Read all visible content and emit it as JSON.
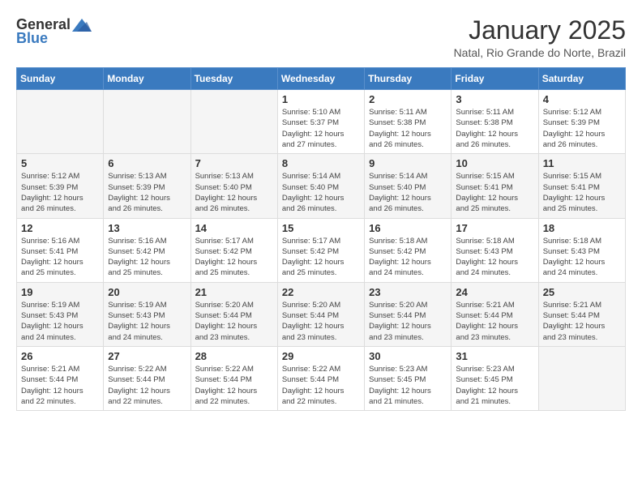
{
  "header": {
    "logo": {
      "general": "General",
      "blue": "Blue"
    },
    "title": "January 2025",
    "subtitle": "Natal, Rio Grande do Norte, Brazil"
  },
  "weekdays": [
    "Sunday",
    "Monday",
    "Tuesday",
    "Wednesday",
    "Thursday",
    "Friday",
    "Saturday"
  ],
  "weeks": [
    [
      {
        "day": "",
        "info": ""
      },
      {
        "day": "",
        "info": ""
      },
      {
        "day": "",
        "info": ""
      },
      {
        "day": "1",
        "info": "Sunrise: 5:10 AM\nSunset: 5:37 PM\nDaylight: 12 hours\nand 27 minutes."
      },
      {
        "day": "2",
        "info": "Sunrise: 5:11 AM\nSunset: 5:38 PM\nDaylight: 12 hours\nand 26 minutes."
      },
      {
        "day": "3",
        "info": "Sunrise: 5:11 AM\nSunset: 5:38 PM\nDaylight: 12 hours\nand 26 minutes."
      },
      {
        "day": "4",
        "info": "Sunrise: 5:12 AM\nSunset: 5:39 PM\nDaylight: 12 hours\nand 26 minutes."
      }
    ],
    [
      {
        "day": "5",
        "info": "Sunrise: 5:12 AM\nSunset: 5:39 PM\nDaylight: 12 hours\nand 26 minutes."
      },
      {
        "day": "6",
        "info": "Sunrise: 5:13 AM\nSunset: 5:39 PM\nDaylight: 12 hours\nand 26 minutes."
      },
      {
        "day": "7",
        "info": "Sunrise: 5:13 AM\nSunset: 5:40 PM\nDaylight: 12 hours\nand 26 minutes."
      },
      {
        "day": "8",
        "info": "Sunrise: 5:14 AM\nSunset: 5:40 PM\nDaylight: 12 hours\nand 26 minutes."
      },
      {
        "day": "9",
        "info": "Sunrise: 5:14 AM\nSunset: 5:40 PM\nDaylight: 12 hours\nand 26 minutes."
      },
      {
        "day": "10",
        "info": "Sunrise: 5:15 AM\nSunset: 5:41 PM\nDaylight: 12 hours\nand 25 minutes."
      },
      {
        "day": "11",
        "info": "Sunrise: 5:15 AM\nSunset: 5:41 PM\nDaylight: 12 hours\nand 25 minutes."
      }
    ],
    [
      {
        "day": "12",
        "info": "Sunrise: 5:16 AM\nSunset: 5:41 PM\nDaylight: 12 hours\nand 25 minutes."
      },
      {
        "day": "13",
        "info": "Sunrise: 5:16 AM\nSunset: 5:42 PM\nDaylight: 12 hours\nand 25 minutes."
      },
      {
        "day": "14",
        "info": "Sunrise: 5:17 AM\nSunset: 5:42 PM\nDaylight: 12 hours\nand 25 minutes."
      },
      {
        "day": "15",
        "info": "Sunrise: 5:17 AM\nSunset: 5:42 PM\nDaylight: 12 hours\nand 25 minutes."
      },
      {
        "day": "16",
        "info": "Sunrise: 5:18 AM\nSunset: 5:42 PM\nDaylight: 12 hours\nand 24 minutes."
      },
      {
        "day": "17",
        "info": "Sunrise: 5:18 AM\nSunset: 5:43 PM\nDaylight: 12 hours\nand 24 minutes."
      },
      {
        "day": "18",
        "info": "Sunrise: 5:18 AM\nSunset: 5:43 PM\nDaylight: 12 hours\nand 24 minutes."
      }
    ],
    [
      {
        "day": "19",
        "info": "Sunrise: 5:19 AM\nSunset: 5:43 PM\nDaylight: 12 hours\nand 24 minutes."
      },
      {
        "day": "20",
        "info": "Sunrise: 5:19 AM\nSunset: 5:43 PM\nDaylight: 12 hours\nand 24 minutes."
      },
      {
        "day": "21",
        "info": "Sunrise: 5:20 AM\nSunset: 5:44 PM\nDaylight: 12 hours\nand 23 minutes."
      },
      {
        "day": "22",
        "info": "Sunrise: 5:20 AM\nSunset: 5:44 PM\nDaylight: 12 hours\nand 23 minutes."
      },
      {
        "day": "23",
        "info": "Sunrise: 5:20 AM\nSunset: 5:44 PM\nDaylight: 12 hours\nand 23 minutes."
      },
      {
        "day": "24",
        "info": "Sunrise: 5:21 AM\nSunset: 5:44 PM\nDaylight: 12 hours\nand 23 minutes."
      },
      {
        "day": "25",
        "info": "Sunrise: 5:21 AM\nSunset: 5:44 PM\nDaylight: 12 hours\nand 23 minutes."
      }
    ],
    [
      {
        "day": "26",
        "info": "Sunrise: 5:21 AM\nSunset: 5:44 PM\nDaylight: 12 hours\nand 22 minutes."
      },
      {
        "day": "27",
        "info": "Sunrise: 5:22 AM\nSunset: 5:44 PM\nDaylight: 12 hours\nand 22 minutes."
      },
      {
        "day": "28",
        "info": "Sunrise: 5:22 AM\nSunset: 5:44 PM\nDaylight: 12 hours\nand 22 minutes."
      },
      {
        "day": "29",
        "info": "Sunrise: 5:22 AM\nSunset: 5:44 PM\nDaylight: 12 hours\nand 22 minutes."
      },
      {
        "day": "30",
        "info": "Sunrise: 5:23 AM\nSunset: 5:45 PM\nDaylight: 12 hours\nand 21 minutes."
      },
      {
        "day": "31",
        "info": "Sunrise: 5:23 AM\nSunset: 5:45 PM\nDaylight: 12 hours\nand 21 minutes."
      },
      {
        "day": "",
        "info": ""
      }
    ]
  ]
}
